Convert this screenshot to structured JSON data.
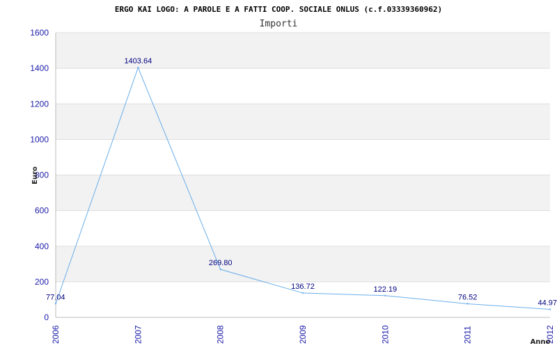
{
  "chart_data": {
    "type": "line",
    "title": "ERGO KAI LOGO: A PAROLE E A FATTI COOP. SOCIALE ONLUS (c.f.03339360962)",
    "subtitle": "Importi",
    "xlabel": "Anno",
    "ylabel": "Euro",
    "x": [
      "2006",
      "2007",
      "2008",
      "2009",
      "2010",
      "2011",
      "2012"
    ],
    "values": [
      77.04,
      1403.64,
      269.8,
      136.72,
      122.19,
      76.52,
      44.97
    ],
    "data_labels": [
      "77.04",
      "1403.64",
      "269.80",
      "136.72",
      "122.19",
      "76.52",
      "44.97"
    ],
    "y_ticks": [
      "0",
      "200",
      "400",
      "600",
      "800",
      "1000",
      "1200",
      "1400",
      "1600"
    ],
    "ylim": [
      0,
      1600
    ],
    "grid": true,
    "colors": {
      "line": "#6aaeea",
      "band": "#f2f2f2",
      "grid": "#dddddd",
      "tick_text": "#1a1aaa",
      "data_label": "#000080"
    }
  }
}
